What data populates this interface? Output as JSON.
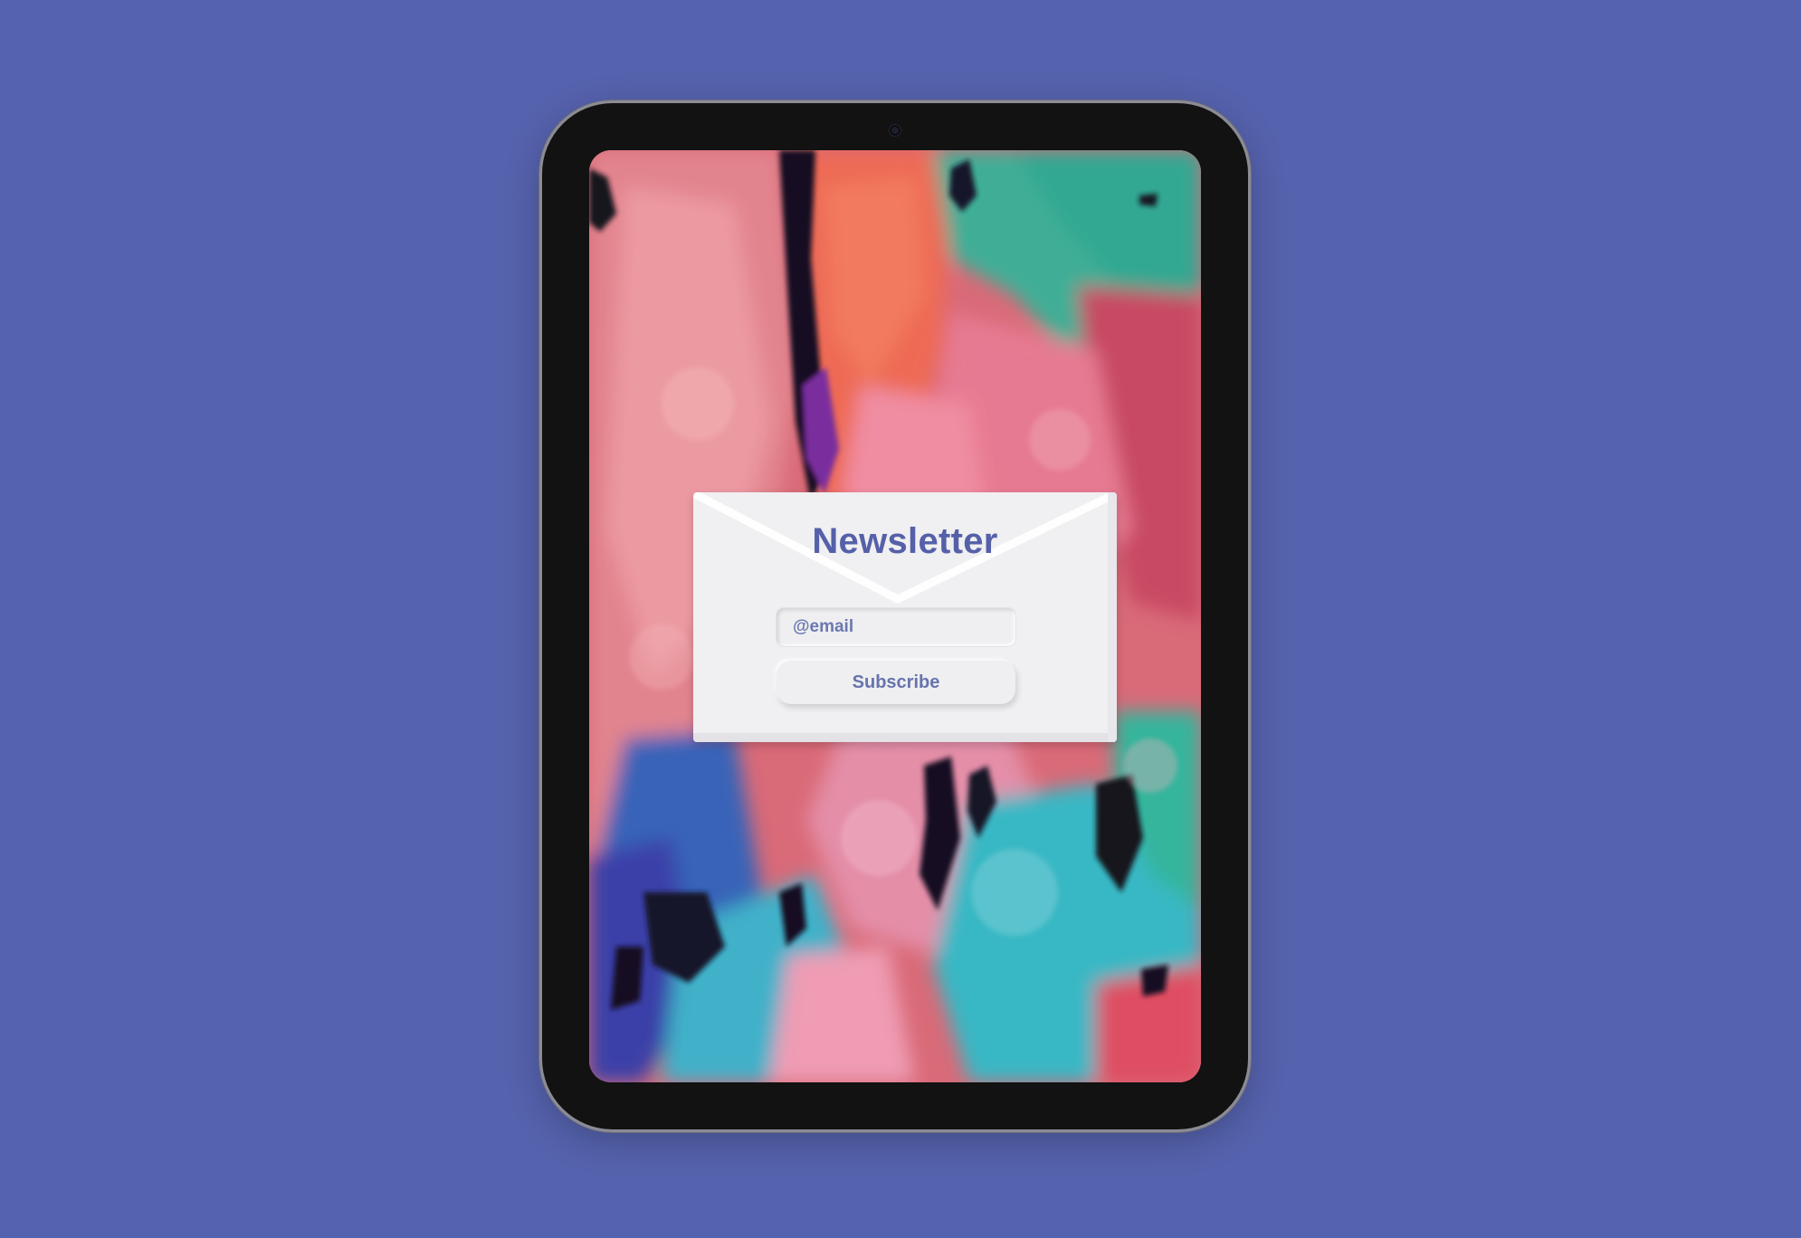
{
  "newsletter": {
    "title": "Newsletter",
    "email_placeholder": "@email",
    "subscribe_label": "Subscribe"
  },
  "colors": {
    "page_background": "#5562ad",
    "device_frame": "#121212",
    "card_background": "#f0eff1",
    "accent_text": "#5560a9",
    "field_text": "#6b78b0"
  }
}
